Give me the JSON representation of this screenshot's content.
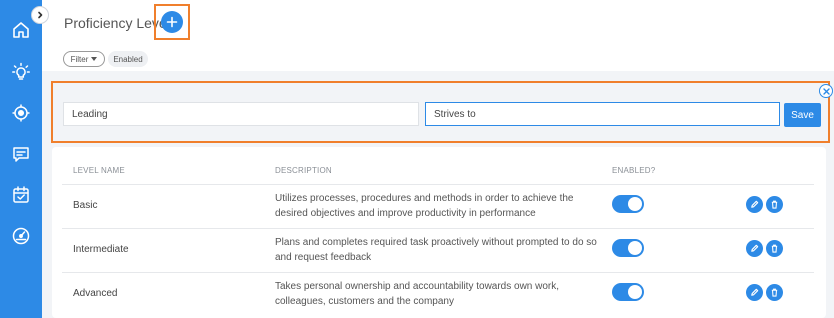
{
  "header": {
    "title": "Proficiency Level",
    "filter_label": "Filter",
    "enabled_chip": "Enabled"
  },
  "edit_form": {
    "name_value": "Leading",
    "description_value": "Strives to",
    "save_label": "Save"
  },
  "table": {
    "columns": [
      "LEVEL NAME",
      "DESCRIPTION",
      "ENABLED?"
    ],
    "rows": [
      {
        "name": "Basic",
        "description": "Utilizes processes, procedures and methods in order to achieve the desired objectives and improve productivity in performance",
        "enabled": true
      },
      {
        "name": "Intermediate",
        "description": "Plans and completes required task proactively without prompted to do so and request feedback",
        "enabled": true
      },
      {
        "name": "Advanced",
        "description": "Takes personal ownership and accountability towards own work, colleagues, customers and the company",
        "enabled": true
      }
    ]
  },
  "sidebar": {
    "icons": [
      "home-icon",
      "lightbulb-icon",
      "target-icon",
      "chat-icon",
      "calendar-check-icon",
      "dashboard-icon"
    ]
  },
  "colors": {
    "accent": "#2d8ae6",
    "highlight": "#f07f2c"
  }
}
